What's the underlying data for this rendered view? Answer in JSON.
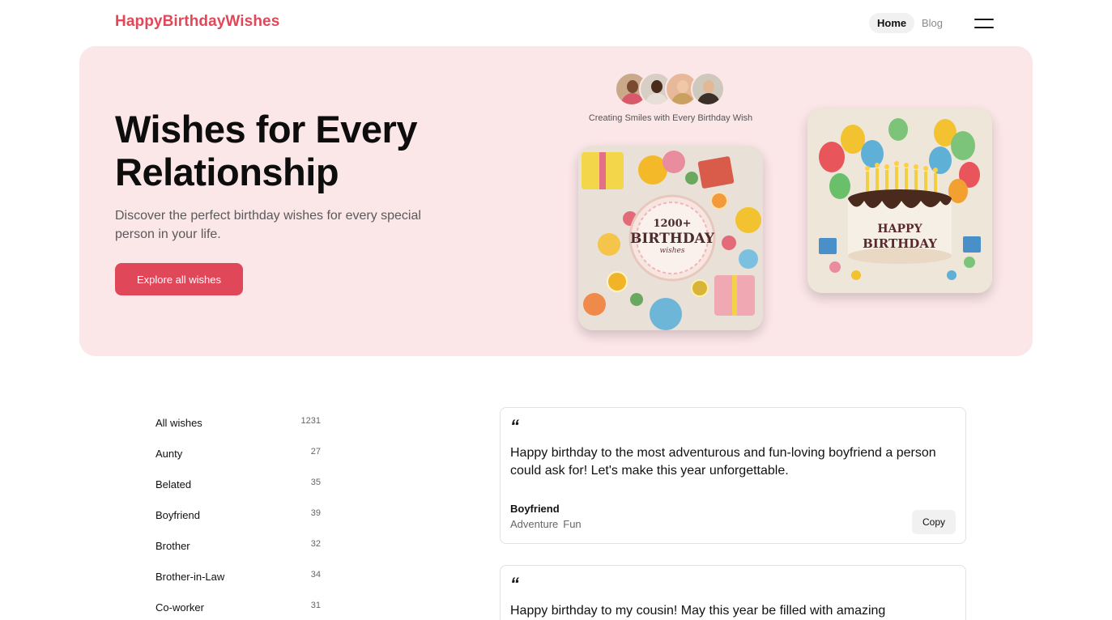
{
  "header": {
    "logo": "HappyBirthdayWishes",
    "nav": {
      "home": "Home",
      "blog": "Blog"
    },
    "menu_icon": "hamburger-menu-icon"
  },
  "hero": {
    "title": "Wishes for Every Relationship",
    "subtitle": "Discover the perfect birthday wishes for every special person in your life.",
    "cta": "Explore all wishes",
    "tagline": "Creating Smiles with Every Birthday Wish",
    "image_1_text": {
      "line1": "1200+",
      "line2": "BIRTHDAY",
      "line3": "wishes"
    },
    "image_2_text": {
      "line1": "HAPPY",
      "line2": "BIRTHDAY"
    }
  },
  "sidebar": {
    "items": [
      {
        "label": "All wishes",
        "count": "1231"
      },
      {
        "label": "Aunty",
        "count": "27"
      },
      {
        "label": "Belated",
        "count": "35"
      },
      {
        "label": "Boyfriend",
        "count": "39"
      },
      {
        "label": "Brother",
        "count": "32"
      },
      {
        "label": "Brother-in-Law",
        "count": "34"
      },
      {
        "label": "Co-worker",
        "count": "31"
      }
    ]
  },
  "wishes": [
    {
      "quote": "“",
      "text": "Happy birthday to the most adventurous and fun-loving boyfriend a person could ask for! Let's make this year unforgettable.",
      "category": "Boyfriend",
      "tags": [
        "Adventure",
        "Fun"
      ],
      "copy_label": "Copy"
    },
    {
      "quote": "“",
      "text": "Happy birthday to my cousin! May this year be filled with amazing"
    }
  ],
  "colors": {
    "brand": "#e0485a",
    "hero_bg": "#fbe6e8"
  }
}
